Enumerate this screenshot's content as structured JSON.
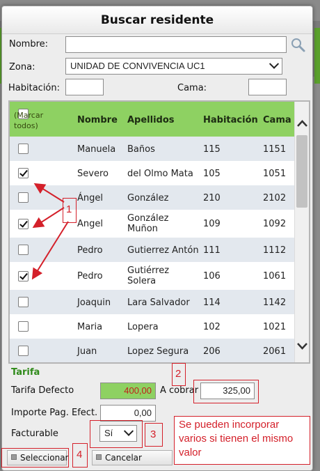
{
  "dialog": {
    "title": "Buscar residente",
    "nombre_label": "Nombre:",
    "nombre_value": "",
    "zona_label": "Zona:",
    "zona_value": "UNIDAD DE CONVIVENCIA UC1",
    "habitacion_label": "Habitación:",
    "habitacion_value": "",
    "cama_label": "Cama:",
    "cama_value": ""
  },
  "table": {
    "marcar_todos": "(Marcar todos)",
    "headers": {
      "nombre": "Nombre",
      "apellidos": "Apellidos",
      "habitacion": "Habitación",
      "cama": "Cama"
    },
    "rows": [
      {
        "checked": false,
        "nombre": "Manuela",
        "apellidos": "Baños",
        "habitacion": "115",
        "cama": "1151"
      },
      {
        "checked": true,
        "nombre": "Severo",
        "apellidos": "del Olmo Mata",
        "habitacion": "105",
        "cama": "1051"
      },
      {
        "checked": false,
        "nombre": "Ángel",
        "apellidos": "González",
        "habitacion": "210",
        "cama": "2102"
      },
      {
        "checked": true,
        "nombre": "Angel",
        "apellidos": "González Muñon",
        "habitacion": "109",
        "cama": "1092"
      },
      {
        "checked": false,
        "nombre": "Pedro",
        "apellidos": "Gutierrez Antón",
        "habitacion": "111",
        "cama": "1112"
      },
      {
        "checked": true,
        "nombre": "Pedro",
        "apellidos": "Gutiérrez Solera",
        "habitacion": "106",
        "cama": "1061"
      },
      {
        "checked": false,
        "nombre": "Joaquin",
        "apellidos": "Lara Salvador",
        "habitacion": "114",
        "cama": "1142"
      },
      {
        "checked": false,
        "nombre": "Maria",
        "apellidos": "Lopera",
        "habitacion": "102",
        "cama": "1021"
      },
      {
        "checked": false,
        "nombre": "Juan",
        "apellidos": "Lopez Segura",
        "habitacion": "206",
        "cama": "2061"
      }
    ]
  },
  "tarifa": {
    "section_label": "Tarifa",
    "defecto_label": "Tarifa Defecto",
    "defecto_value": "400,00",
    "acobrar_label": "A cobrar",
    "acobrar_value": "325,00",
    "importe_label": "Importe Pag. Efect.",
    "importe_value": "0,00",
    "facturable_label": "Facturable",
    "facturable_value": "Sí"
  },
  "buttons": {
    "seleccionar": "Seleccionar",
    "cancelar": "Cancelar"
  },
  "annotations": {
    "n1": "1",
    "n2": "2",
    "n3": "3",
    "n4": "4",
    "note": "Se pueden incorporar varios si tienen el mismo valor"
  },
  "colors": {
    "header_green": "#8ed162",
    "annotation_red": "#d4202a",
    "tarifa_green": "#2f8a1a"
  }
}
